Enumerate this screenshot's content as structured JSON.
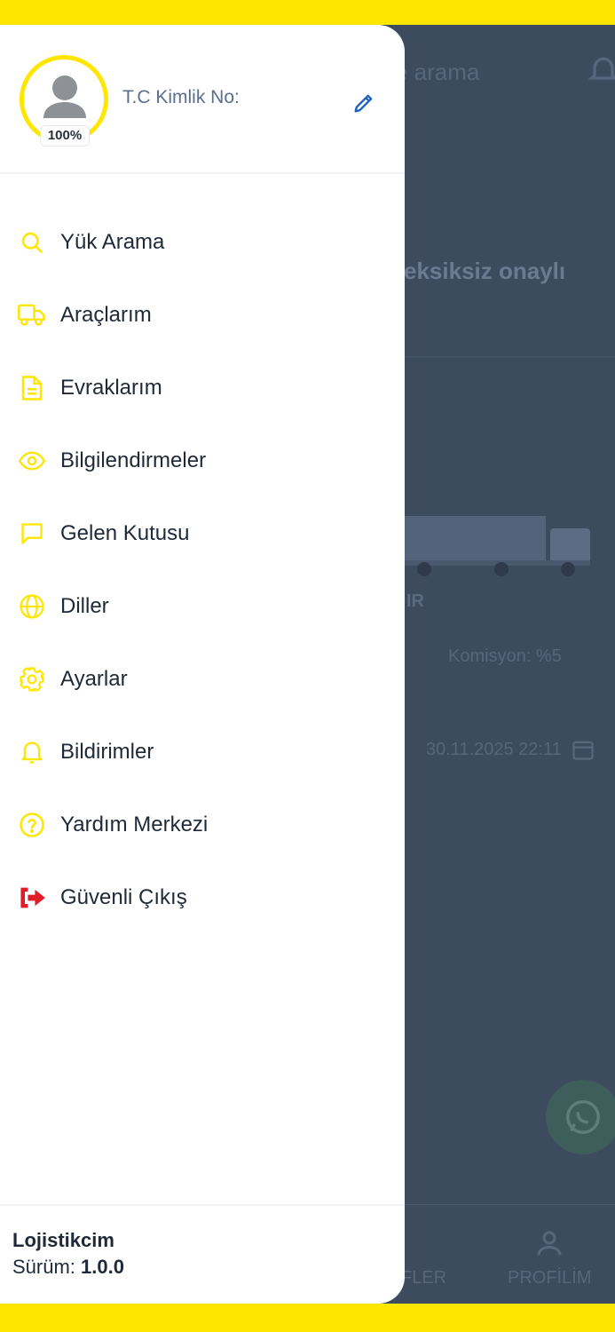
{
  "colors": {
    "accent": "#ffe600",
    "exit": "#e11d2a",
    "edit": "#1f5fb8",
    "overlay": "#3d4b5f"
  },
  "background": {
    "search_text": "e arama",
    "headline": "eksiksiz onaylı",
    "ir_text": "IR",
    "komisyon": "Komisyon: %5",
    "date": "30.11.2025 22:11",
    "nav_left": "FLER",
    "nav_right": "PROFİLİM"
  },
  "profile": {
    "completion": "100%",
    "tc_label": "T.C Kimlik No:",
    "icon": "edit-icon"
  },
  "menu": {
    "items": [
      {
        "label": "Yük Arama",
        "icon": "search-icon"
      },
      {
        "label": "Araçlarım",
        "icon": "truck-icon"
      },
      {
        "label": "Evraklarım",
        "icon": "document-icon"
      },
      {
        "label": "Bilgilendirmeler",
        "icon": "eye-icon"
      },
      {
        "label": "Gelen Kutusu",
        "icon": "message-icon"
      },
      {
        "label": "Diller",
        "icon": "globe-icon"
      },
      {
        "label": "Ayarlar",
        "icon": "gear-icon"
      },
      {
        "label": "Bildirimler",
        "icon": "bell-icon"
      },
      {
        "label": "Yardım Merkezi",
        "icon": "help-icon"
      },
      {
        "label": "Güvenli Çıkış",
        "icon": "logout-icon"
      }
    ]
  },
  "footer": {
    "app_name": "Lojistikcim",
    "version_label": "Sürüm:",
    "version_value": "1.0.0"
  }
}
